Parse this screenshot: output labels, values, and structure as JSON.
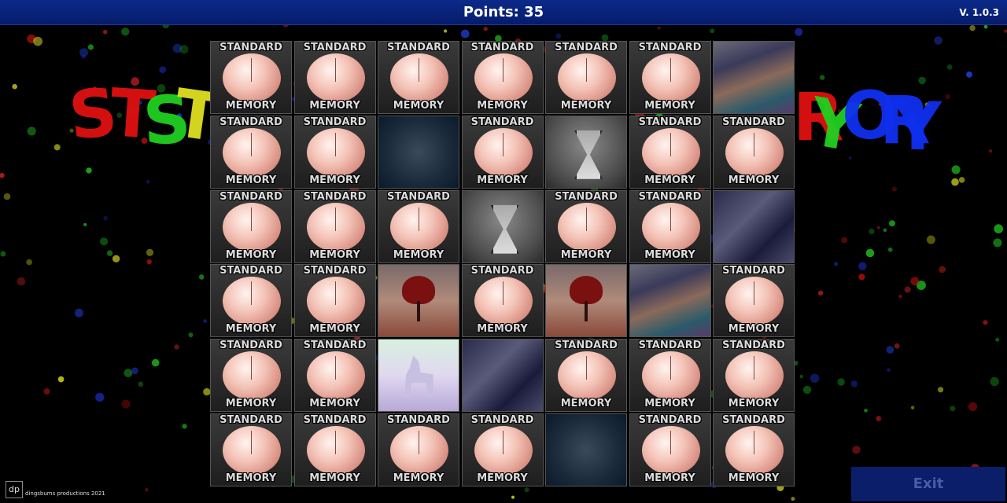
{
  "header": {
    "points_label": "Points: 35",
    "version": "V. 1.0.3"
  },
  "card_back": {
    "top_text": "STANDARD",
    "bottom_text": "MEMORY",
    "icon": "brain-icon"
  },
  "logo_fragments": {
    "left": "STST",
    "right": "ORY"
  },
  "board": {
    "rows": 6,
    "cols": 7,
    "cells": [
      [
        "back",
        "back",
        "back",
        "back",
        "back",
        "back",
        "stairs"
      ],
      [
        "back",
        "back",
        "fractal",
        "back",
        "hourglass",
        "back",
        "back"
      ],
      [
        "back",
        "back",
        "back",
        "hourglass",
        "back",
        "back",
        "horses"
      ],
      [
        "back",
        "back",
        "heart-tree",
        "back",
        "heart-tree",
        "stairs",
        "back"
      ],
      [
        "back",
        "back",
        "unicorn",
        "horses",
        "back",
        "back",
        "back"
      ],
      [
        "back",
        "back",
        "back",
        "back",
        "fractal",
        "back",
        "back"
      ]
    ]
  },
  "footer": {
    "logo": "dp",
    "credit": "dingsbums productions 2021",
    "exit_label": "Exit"
  },
  "colors": {
    "topbar": "#0c2a8a",
    "exit_bg": "#0a1e6a"
  }
}
